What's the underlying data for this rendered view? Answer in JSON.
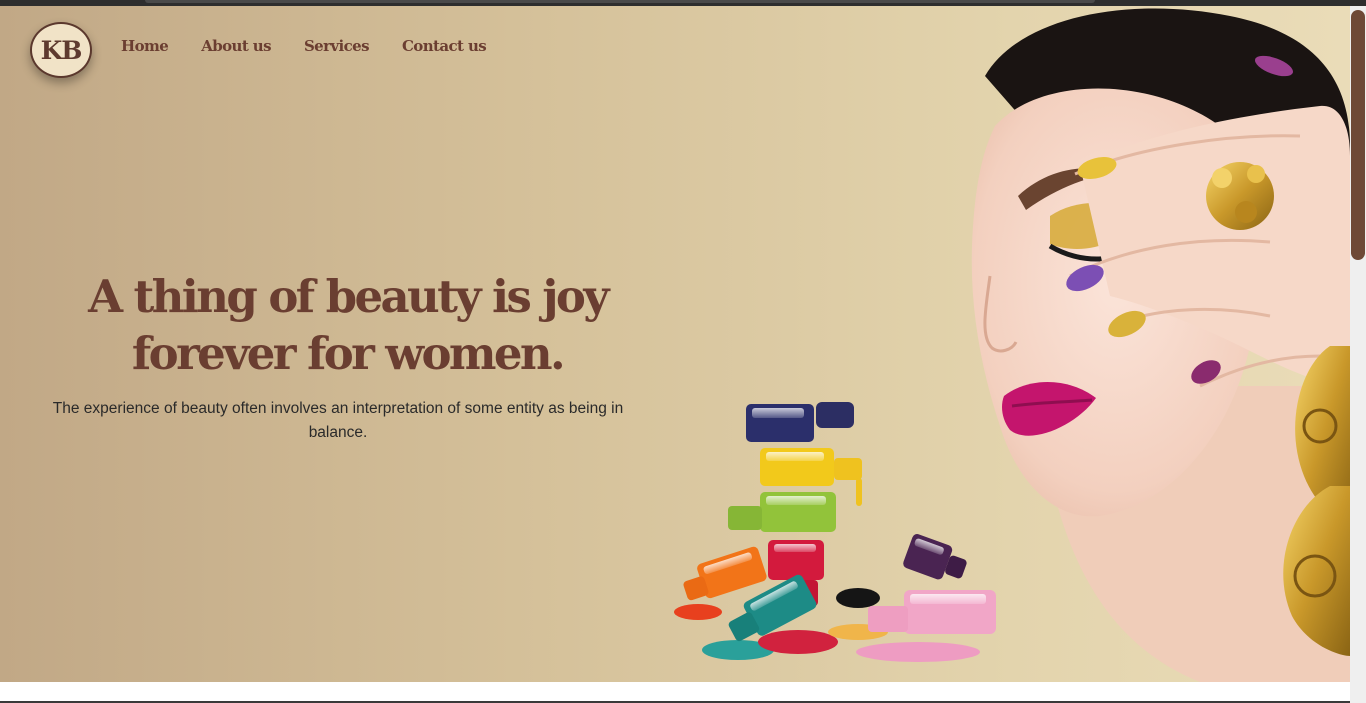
{
  "logo": {
    "text": "KB"
  },
  "nav": {
    "home": "Home",
    "about": "About us",
    "services": "Services",
    "contact": "Contact us"
  },
  "hero": {
    "headline_line1": "A thing of beauty is joy",
    "headline_line2": "forever for women.",
    "subtext": "The experience of beauty often involves an interpretation of some entity as being in balance."
  },
  "colors": {
    "brand_brown": "#6a3e31",
    "hero_left": "#c1a886",
    "hero_right": "#eadcb8",
    "scroll_thumb": "#6e4937"
  },
  "images": {
    "model": "woman-with-jewelry-and-painted-nails",
    "polish": "stacked-nail-polish-bottles"
  }
}
